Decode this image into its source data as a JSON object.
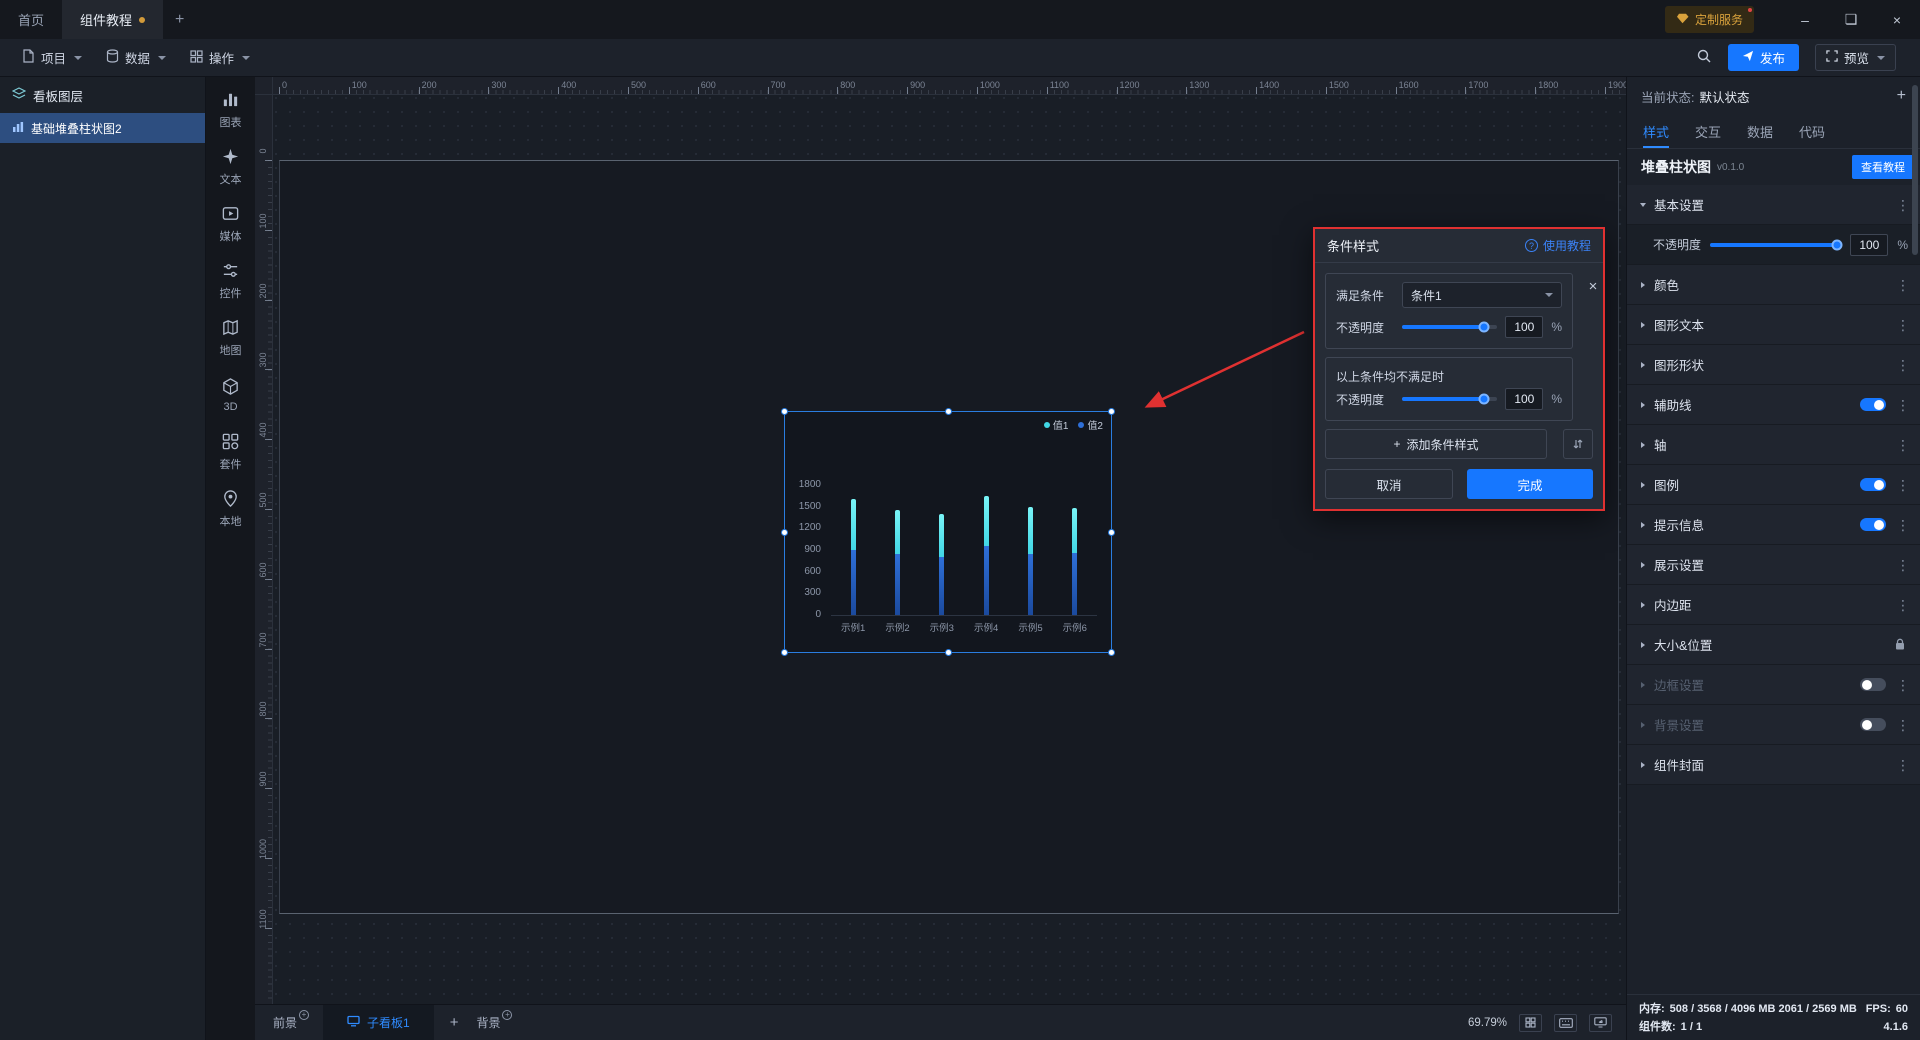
{
  "accent_color": "#1677ff",
  "title_bar": {
    "tabs": [
      {
        "label": "首页",
        "active": false
      },
      {
        "label": "组件教程",
        "active": true,
        "dot": true
      }
    ],
    "new_tab_label": "+",
    "custom_service_label": "定制服务",
    "window_controls": {
      "minimize": "–",
      "maximize": "❏",
      "close": "×"
    }
  },
  "toolbar": {
    "menus": [
      {
        "label": "项目",
        "icon": "project-icon"
      },
      {
        "label": "数据",
        "icon": "data-icon"
      },
      {
        "label": "操作",
        "icon": "operate-icon"
      }
    ],
    "publish_label": "发布",
    "preview_label": "预览"
  },
  "layers_panel": {
    "title": "看板图层",
    "items": [
      {
        "label": "基础堆叠柱状图2",
        "selected": true
      }
    ]
  },
  "component_dock": {
    "items": [
      {
        "label": "图表",
        "icon": "chart-icon"
      },
      {
        "label": "文本",
        "icon": "text-icon"
      },
      {
        "label": "媒体",
        "icon": "media-icon"
      },
      {
        "label": "控件",
        "icon": "control-icon"
      },
      {
        "label": "地图",
        "icon": "map-icon"
      },
      {
        "label": "3D",
        "icon": "cube-icon"
      },
      {
        "label": "套件",
        "icon": "kit-icon"
      },
      {
        "label": "本地",
        "icon": "local-icon"
      }
    ]
  },
  "canvas": {
    "ruler_top": [
      "0",
      "100",
      "200",
      "300",
      "400",
      "500",
      "600",
      "700",
      "800",
      "900",
      "1000",
      "1100",
      "1200",
      "1300",
      "1400",
      "1500",
      "1600",
      "1700",
      "1800",
      "1900"
    ],
    "ruler_left": [
      "0",
      "100",
      "200",
      "300",
      "400",
      "500",
      "600",
      "700",
      "800",
      "900",
      "1000",
      "1100"
    ]
  },
  "chart_data": {
    "type": "bar",
    "stacked": true,
    "title": "",
    "categories": [
      "示例1",
      "示例2",
      "示例3",
      "示例4",
      "示例5",
      "示例6"
    ],
    "series": [
      {
        "name": "值1",
        "color": "#41d7e6",
        "values": [
          700,
          600,
          600,
          700,
          650,
          620
        ]
      },
      {
        "name": "值2",
        "color": "#2e6fd8",
        "values": [
          900,
          850,
          800,
          950,
          850,
          860
        ]
      }
    ],
    "ylim": [
      0,
      1800
    ],
    "yticks": [
      0,
      300,
      600,
      900,
      1200,
      1500,
      1800
    ],
    "legend_position": "top-right",
    "grid": false
  },
  "popup": {
    "title": "条件样式",
    "help_label": "使用教程",
    "condition_label": "满足条件",
    "condition_value": "条件1",
    "opacity_label": "不透明度",
    "opacity_value": "100",
    "fallback_opacity_value": "100",
    "unit": "%",
    "fallback_label": "以上条件均不满足时",
    "add_button_label": "添加条件样式",
    "cancel_label": "取消",
    "confirm_label": "完成"
  },
  "right_panel": {
    "state_label": "当前状态:",
    "state_value": "默认状态",
    "tabs": [
      {
        "label": "样式",
        "active": true
      },
      {
        "label": "交互",
        "active": false
      },
      {
        "label": "数据",
        "active": false
      },
      {
        "label": "代码",
        "active": false
      }
    ],
    "component_name": "堆叠柱状图",
    "component_version": "v0.1.0",
    "tutorial_button_label": "查看教程",
    "opacity_label": "不透明度",
    "opacity_value": "100",
    "unit": "%",
    "sections": [
      {
        "label": "基本设置",
        "expanded": true
      },
      {
        "label": "颜色"
      },
      {
        "label": "图形文本"
      },
      {
        "label": "图形形状"
      },
      {
        "label": "辅助线",
        "toggle": "on"
      },
      {
        "label": "轴"
      },
      {
        "label": "图例",
        "toggle": "on"
      },
      {
        "label": "提示信息",
        "toggle": "on"
      },
      {
        "label": "展示设置"
      },
      {
        "label": "内边距"
      },
      {
        "label": "大小&位置",
        "lock": true
      },
      {
        "label": "边框设置",
        "toggle": "off",
        "disabled": true
      },
      {
        "label": "背景设置",
        "toggle": "off",
        "disabled": true
      },
      {
        "label": "组件封面"
      }
    ],
    "stats": {
      "memory_label": "内存:",
      "memory_value": "508 / 3568 / 4096 MB  2061 / 2569 MB",
      "fps_label": "FPS:",
      "fps_value": "60",
      "components_label": "组件数:",
      "components_value": "1 / 1",
      "version": "4.1.6"
    }
  },
  "bottom_bar": {
    "foreground_label": "前景",
    "board_tab_label": "子看板1",
    "add_board_label": "+",
    "background_label": "背景",
    "zoom_value": "69.79%"
  }
}
